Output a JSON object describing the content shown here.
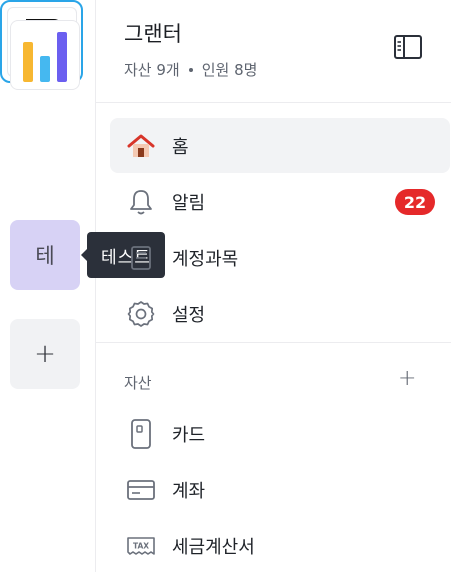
{
  "workspaces": {
    "test_initial": "테",
    "add_symbol": "+",
    "tooltip": "테스트"
  },
  "header": {
    "title": "그랜터",
    "assets_count": "자산 9개",
    "members_count": "인원 8명"
  },
  "nav": {
    "home": "홈",
    "alerts": "알림",
    "alerts_badge": "22",
    "accounts": "계정과목",
    "settings": "설정"
  },
  "assets": {
    "section_label": "자산",
    "add_symbol": "+",
    "card": "카드",
    "bank_account": "계좌",
    "tax_invoice": "세금계산서"
  },
  "colors": {
    "accent_blue": "#2aa5e8",
    "badge_red": "#e5292a",
    "home_icon_red": "#d8352a"
  }
}
